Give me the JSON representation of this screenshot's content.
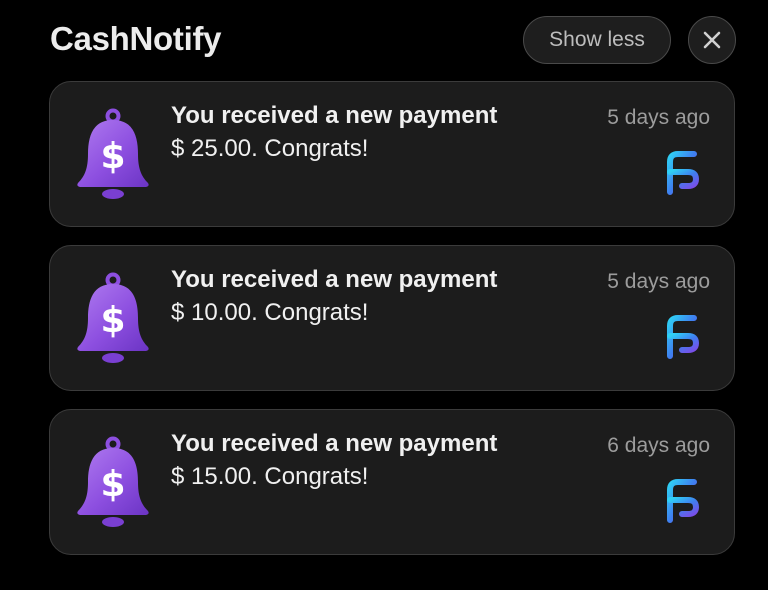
{
  "header": {
    "app_name": "CashNotify",
    "show_less_label": "Show less"
  },
  "notifications": [
    {
      "title": "You received a new payment",
      "body": "$ 25.00. Congrats!",
      "time": "5 days ago"
    },
    {
      "title": "You received a new payment",
      "body": "$ 10.00. Congrats!",
      "time": "5 days ago"
    },
    {
      "title": "You received a new payment",
      "body": "$ 15.00. Congrats!",
      "time": "6 days ago"
    }
  ],
  "icons": {
    "notification": "bell-dollar-icon",
    "app": "app-logo-icon",
    "close": "close-icon"
  },
  "colors": {
    "background": "#000000",
    "card": "#1c1c1c",
    "bell_purple": "#8a4dd8",
    "logo_blue": "#3c8ff0"
  }
}
